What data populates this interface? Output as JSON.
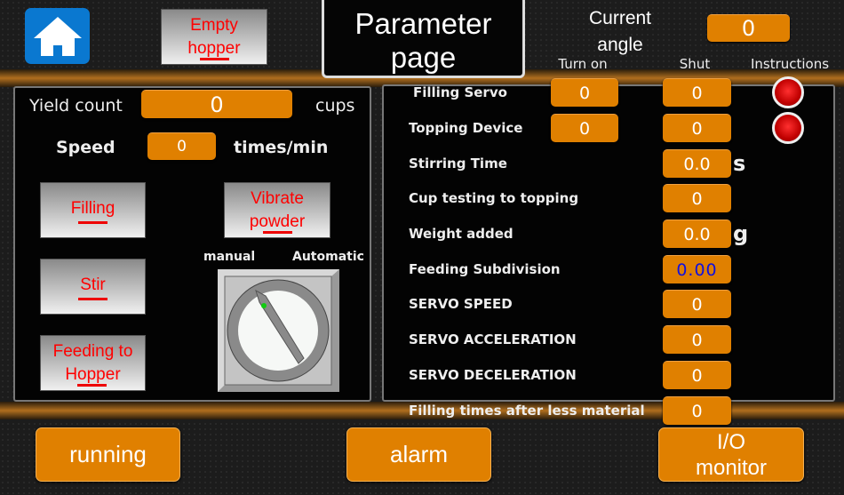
{
  "header": {
    "title": "Parameter page",
    "current_angle_label": "Current angle",
    "current_angle_value": "0",
    "empty_hopper": "Empty hopper",
    "home_icon": "home-icon"
  },
  "left": {
    "yield_label": "Yield count",
    "yield_value": "0",
    "yield_unit": "cups",
    "speed_label": "Speed",
    "speed_value": "0",
    "speed_unit": "times/min",
    "buttons": {
      "filling": "Filling",
      "stir": "Stir",
      "feeding": "Feeding to Hopper",
      "vibrate": "Vibrate powder"
    },
    "switch": {
      "manual": "manual",
      "automatic": "Automatic",
      "position": "manual"
    }
  },
  "right": {
    "columns": {
      "turn_on": "Turn on",
      "shut": "Shut",
      "instructions": "Instructions"
    },
    "rows": [
      {
        "label": "Filling Servo",
        "turn_on": "0",
        "shut": "0",
        "indicator": "red"
      },
      {
        "label": "Topping Device",
        "turn_on": "0",
        "shut": "0",
        "indicator": "red"
      },
      {
        "label": "Stirring Time",
        "value": "0.0",
        "unit": "s"
      },
      {
        "label": "Cup testing to topping",
        "value": "0"
      },
      {
        "label": "Weight added",
        "value": "0.0",
        "unit": "g"
      },
      {
        "label": "Feeding Subdivision",
        "value": "0.00"
      },
      {
        "label": "SERVO SPEED",
        "value": "0"
      },
      {
        "label": "SERVO ACCELERATION",
        "value": "0"
      },
      {
        "label": "SERVO DECELERATION",
        "value": "0"
      },
      {
        "label": "Filling times after less material",
        "value": "0"
      }
    ]
  },
  "footer": {
    "running": "running",
    "alarm": "alarm",
    "io_monitor": "I/O monitor"
  },
  "colors": {
    "accent": "#e08000",
    "indicator_off": "#d00000",
    "feeding_subdivision_text": "#1010e0"
  }
}
